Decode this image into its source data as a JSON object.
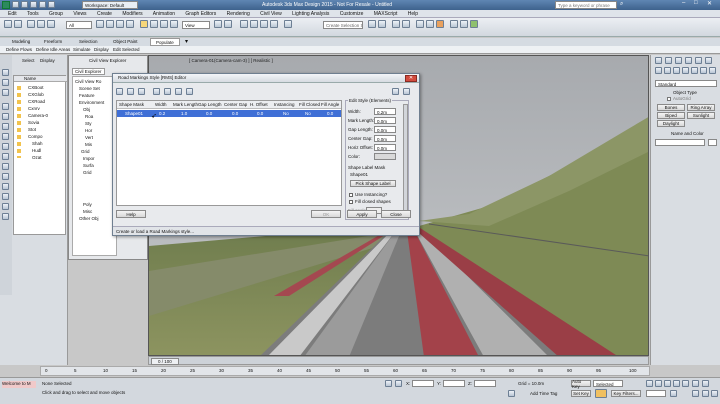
{
  "app": {
    "window_title": "Autodesk 3ds Max Design 2015  -  Not For Resale  -  Untitled",
    "workspace": "Workspace: Default",
    "search_placeholder": "Type a keyword or phrase"
  },
  "menu": [
    "Edit",
    "Tools",
    "Group",
    "Views",
    "Create",
    "Modifiers",
    "Animation",
    "Graph Editors",
    "Rendering",
    "Civil View",
    "Lighting Analysis",
    "Customize",
    "MAXScript",
    "Help"
  ],
  "toolbar": {
    "filter_all": "All",
    "view": "View",
    "selection_set": "Create Selection Se"
  },
  "ribbon_tabs": [
    "Modeling",
    "Freeform",
    "Selection",
    "Object Paint",
    "Populate"
  ],
  "ribbon_items": [
    "Define Flows",
    "Define Idle Areas",
    "Simulate",
    "Display",
    "Edit Selected"
  ],
  "scene_explorer": {
    "tabs": [
      "Select",
      "Display"
    ],
    "header": "Name",
    "items": [
      "CXBoot",
      "CXGlob",
      "CXRoad",
      "Cxnrv",
      "Camera-0",
      "Sovia",
      "Stot",
      "Compo",
      "Shah",
      "Hudl",
      "Ozat"
    ]
  },
  "civil_explorer": {
    "title": "Civil View Explorer",
    "tab": "Civil Explorer",
    "tree": [
      "Civil View Ro",
      "Scene Set",
      "Feature",
      "Environment",
      "Obj",
      "Roa",
      "Sty",
      "Hor",
      "Vert",
      "Mis",
      "Grid",
      "Impor",
      "Surfa",
      "Grid",
      "Poly",
      "Misc",
      "Other Obj"
    ]
  },
  "viewport_label": "[ Camera-01(Camera-cam-3) ] [ Realistic ]",
  "dialog": {
    "title": "Road Markings Style [RMS] Editor",
    "table_headers": [
      "Shape Mask",
      "Width",
      "Mark Length",
      "Gap Length",
      "Center Gap",
      "H. Offset",
      "Instancing",
      "Fill Closed",
      "Fill Angle"
    ],
    "table_row": [
      "Shape01",
      "0.2",
      "1.0",
      "0.0",
      "0.0",
      "0.0",
      "No",
      "No",
      "0.0"
    ],
    "edit_style_title": "Edit Style (Elements)",
    "fields": [
      {
        "label": "Width:",
        "value": "0.2m"
      },
      {
        "label": "Mark Length:",
        "value": "0.0m"
      },
      {
        "label": "Gap Length:",
        "value": "0.0m"
      },
      {
        "label": "Center Gap:",
        "value": "0.0m"
      },
      {
        "label": "Horiz Offset:",
        "value": "0.0m"
      },
      {
        "label": "Color:",
        "value": ""
      }
    ],
    "shape_mask_label": "Shape Label Mask",
    "shape_name": "Shape01",
    "pick_shape_button": "Pick Shape Label",
    "use_instancing": "Use Instancing?",
    "fill_closed": "Fill closed shapes",
    "fill_angle": "Fill angle:",
    "help_button": "Help",
    "ok_button": "OK",
    "apply_button": "Apply",
    "close_button": "Close",
    "status": "Create or load a Road Markings style..."
  },
  "command_panel": {
    "dropdown": "Standard",
    "object_type_title": "Object Type",
    "autogrid": "AutoGrid",
    "buttons": [
      "Bones",
      "Ring Array",
      "Biped",
      "Sunlight",
      "Daylight"
    ],
    "name_color_title": "Name and Color"
  },
  "timeline": {
    "frame": "0 / 100",
    "ticks": [
      "0",
      "5",
      "10",
      "15",
      "20",
      "25",
      "30",
      "35",
      "40",
      "45",
      "50",
      "55",
      "60",
      "65",
      "70",
      "75",
      "80",
      "85",
      "90",
      "95",
      "100"
    ]
  },
  "status_bar": {
    "selection": "None Selected",
    "prompt": "Click and drag to select and move objects",
    "grid": "Grid = 10.0m",
    "auto_key": "Auto Key",
    "selected": "Selected",
    "set_key": "Set Key",
    "key_filters": "Key Filters...",
    "add_time_tag": "Add Time Tag",
    "welcome": "Welcome to M",
    "x_label": "X:",
    "y_label": "Y:",
    "z_label": "Z:"
  },
  "colors": {
    "title_bar": "#4a6f9a",
    "selected_row": "#3f6fd6",
    "road_red": "#a3424a",
    "grass": "#7d8a5a",
    "sky": "#b9bcc0"
  }
}
